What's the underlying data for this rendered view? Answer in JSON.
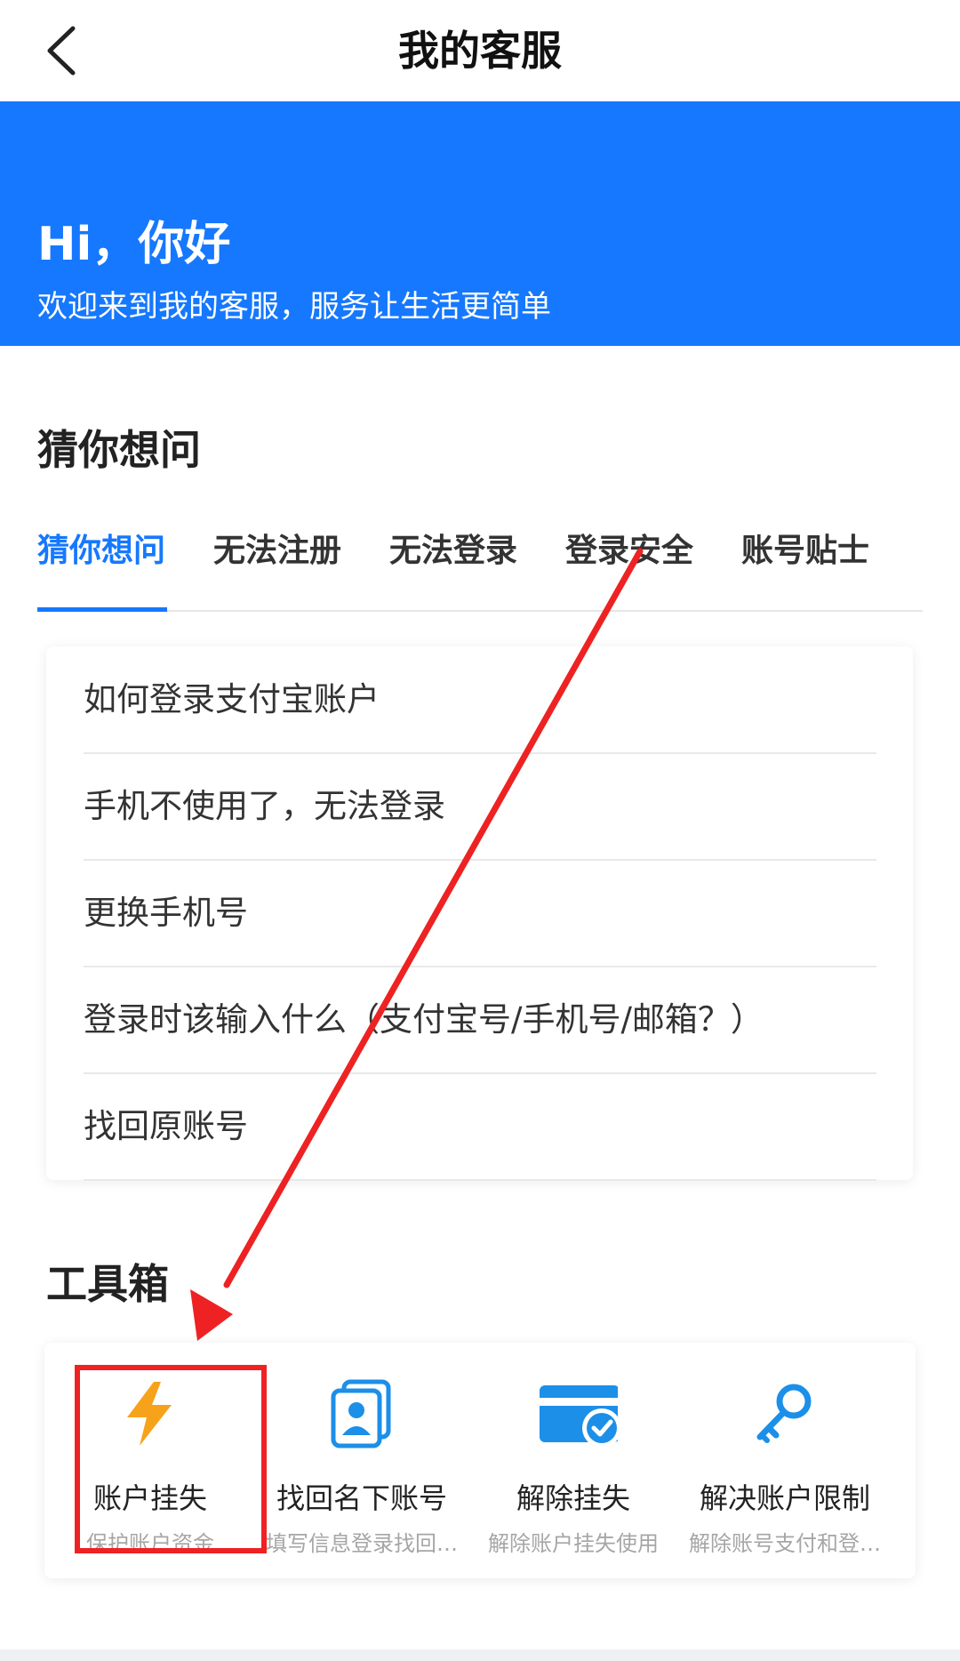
{
  "navbar": {
    "title": "我的客服",
    "back_icon": "chevron-left-icon"
  },
  "banner": {
    "greeting": "Hi，你好",
    "subtitle": "欢迎来到我的客服，服务让生活更简单",
    "background_color": "#1677ff"
  },
  "faq": {
    "section_title": "猜你想问",
    "tabs": [
      {
        "label": "猜你想问",
        "active": true
      },
      {
        "label": "无法注册",
        "active": false
      },
      {
        "label": "无法登录",
        "active": false
      },
      {
        "label": "登录安全",
        "active": false
      },
      {
        "label": "账号贴士",
        "active": false
      }
    ],
    "items": [
      {
        "text": "如何登录支付宝账户"
      },
      {
        "text": "手机不使用了，无法登录"
      },
      {
        "text": "更换手机号"
      },
      {
        "text": "登录时该输入什么（支付宝号/手机号/邮箱？）"
      },
      {
        "text": "找回原账号"
      }
    ]
  },
  "toolbox": {
    "section_title": "工具箱",
    "tools": [
      {
        "name": "账户挂失",
        "desc": "保护账户资金",
        "icon": "lightning-icon",
        "color": "#f7a21b"
      },
      {
        "name": "找回名下账号",
        "desc": "填写信息登录找回…",
        "icon": "id-card-icon",
        "color": "#1c8fe8"
      },
      {
        "name": "解除挂失",
        "desc": "解除账户挂失使用",
        "icon": "card-check-icon",
        "color": "#1c8fe8"
      },
      {
        "name": "解决账户限制",
        "desc": "解除账号支付和登…",
        "icon": "key-icon",
        "color": "#1c8fe8"
      }
    ]
  },
  "annotation": {
    "color": "#ee2222"
  }
}
